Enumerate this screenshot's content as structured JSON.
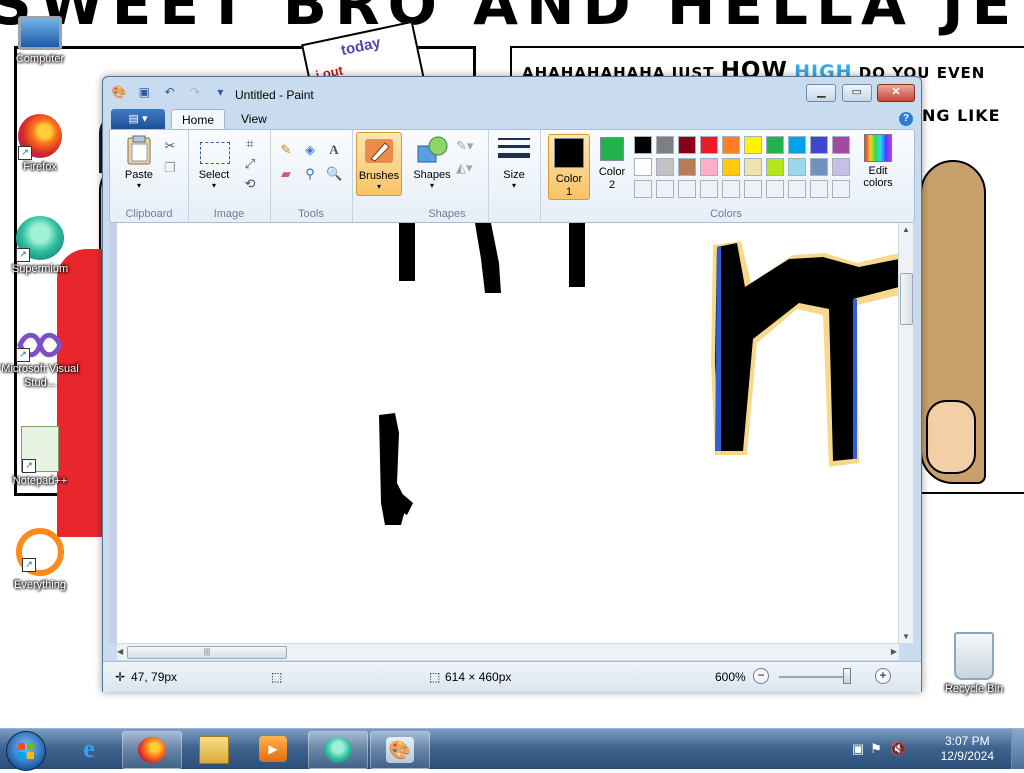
{
  "wallpaper": {
    "title": "SWEET BRO AND HELLA JEFF",
    "sign_line1": "today",
    "sign_line2": "i out",
    "speech_line1_a": "AHAHAHAHAHA JUST",
    "speech_line1_b": "HOW",
    "speech_line1_c": "HIGH",
    "speech_line1_d": "DO YOU EVEN",
    "speech_line2": "NG LIKE"
  },
  "desktop_icons": [
    {
      "label": "Computer",
      "icon": "computer-icon"
    },
    {
      "label": "Firefox",
      "icon": "firefox-icon"
    },
    {
      "label": "Supermium",
      "icon": "supermium-icon"
    },
    {
      "label": "Microsoft Visual Stud...",
      "icon": "visual-studio-icon"
    },
    {
      "label": "Notepad++",
      "icon": "notepad-plus-plus-icon"
    },
    {
      "label": "Everything",
      "icon": "everything-icon"
    },
    {
      "label": "Recycle Bin",
      "icon": "recycle-bin-icon"
    }
  ],
  "paint": {
    "title": "Untitled - Paint",
    "tabs": {
      "file": "▤ ▾",
      "home": "Home",
      "view": "View"
    },
    "groups": {
      "clipboard": {
        "label": "Clipboard",
        "paste": "Paste"
      },
      "image": {
        "label": "Image",
        "select": "Select"
      },
      "tools": {
        "label": "Tools"
      },
      "brushes": {
        "label": "Brushes"
      },
      "shapes": {
        "label": "Shapes",
        "button": "Shapes"
      },
      "size": {
        "label": "Size"
      },
      "colors": {
        "label": "Colors",
        "color1": "Color\n1",
        "color1_a": "Color",
        "color1_b": "1",
        "color2_a": "Color",
        "color2_b": "2",
        "edit_a": "Edit",
        "edit_b": "colors"
      }
    },
    "color1_value": "#000000",
    "color2_value": "#22b14c",
    "palette_row1": [
      "#000000",
      "#7f7f7f",
      "#880015",
      "#ed1c24",
      "#ff7f27",
      "#fff200",
      "#22b14c",
      "#00a2e8",
      "#3f48cc",
      "#a349a4"
    ],
    "palette_row2": [
      "#ffffff",
      "#c3c3c3",
      "#b97a57",
      "#ffaec9",
      "#ffc90e",
      "#efe4b0",
      "#b5e61d",
      "#99d9ea",
      "#7092be",
      "#c8bfe7"
    ],
    "status": {
      "cursor_pos": "47, 79px",
      "canvas_size": "614 × 460px",
      "zoom": "600%"
    }
  },
  "taskbar": {
    "time": "3:07 PM",
    "date": "12/9/2024",
    "apps": [
      "internet-explorer-icon",
      "firefox-icon",
      "file-explorer-icon",
      "media-player-icon",
      "supermium-icon",
      "paint-icon"
    ]
  }
}
